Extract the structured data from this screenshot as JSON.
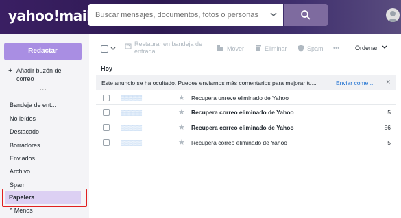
{
  "header": {
    "logo": "yahoo!mail",
    "search_placeholder": "Buscar mensajes, documentos, fotos o personas"
  },
  "sidebar": {
    "compose_label": "Redactar",
    "add_mailbox_label": "Añadir buzón de correo",
    "more_dots": "...",
    "folders": [
      {
        "label": "Bandeja de ent..."
      },
      {
        "label": "No leídos"
      },
      {
        "label": "Destacado"
      },
      {
        "label": "Borradores"
      },
      {
        "label": "Enviados"
      },
      {
        "label": "Archivo"
      },
      {
        "label": "Spam"
      },
      {
        "label": "Papelera"
      }
    ],
    "less_label": "Menos"
  },
  "toolbar": {
    "restore_label": "Restaurar en bandeja de entrada",
    "move_label": "Mover",
    "delete_label": "Eliminar",
    "spam_label": "Spam",
    "more_label": "•••",
    "sort_label": "Ordenar"
  },
  "main": {
    "day_label": "Hoy",
    "notice": {
      "text": "Este anuncio se ha ocultado. Puedes enviarnos más comentarios para mejorar tu...",
      "link": "Enviar come..."
    },
    "messages": [
      {
        "subject": "Recupera unreve eliminado de Yahoo",
        "bold": false,
        "date": ""
      },
      {
        "subject": "Recupera correo eliminado de Yahoo",
        "bold": true,
        "date": "5"
      },
      {
        "subject": "Recupera correo eliminado de Yahoo",
        "bold": true,
        "date": "56"
      },
      {
        "subject": "Recupera correo eliminado de Yahoo",
        "bold": false,
        "date": "5"
      }
    ]
  },
  "colors": {
    "header_bg": "#3a1f63",
    "compose_bg": "#a98ee3",
    "selected_folder_bg": "#dcd0f3",
    "highlight_outline": "#e02020",
    "link": "#1b6fd0"
  }
}
